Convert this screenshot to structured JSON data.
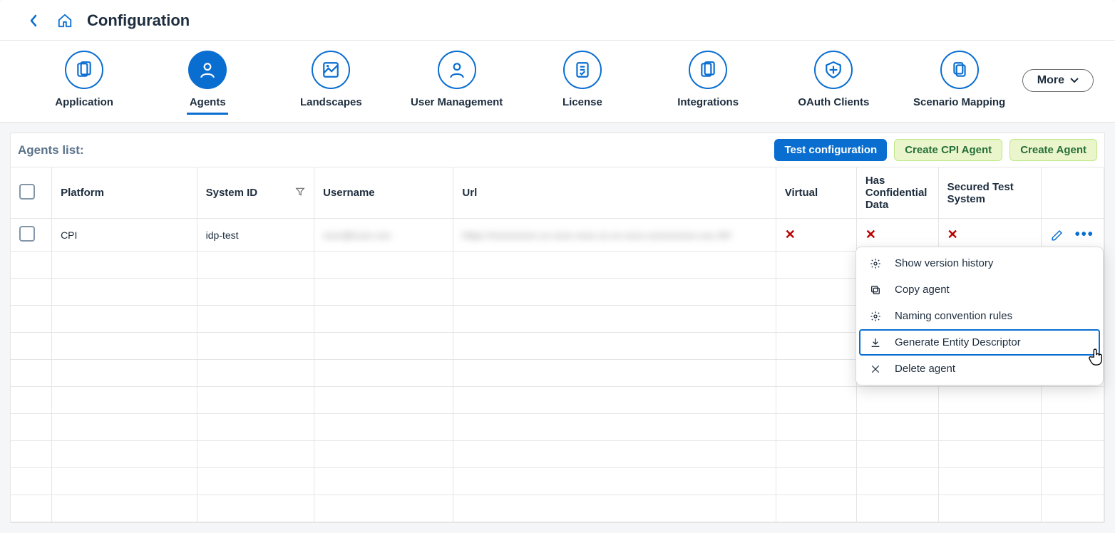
{
  "header": {
    "title": "Configuration"
  },
  "nav": {
    "items": [
      {
        "label": "Application"
      },
      {
        "label": "Agents"
      },
      {
        "label": "Landscapes"
      },
      {
        "label": "User Management"
      },
      {
        "label": "License"
      },
      {
        "label": "Integrations"
      },
      {
        "label": "OAuth Clients"
      },
      {
        "label": "Scenario Mapping"
      }
    ],
    "more_label": "More"
  },
  "agents_list": {
    "title": "Agents list:",
    "buttons": {
      "test_config": "Test configuration",
      "create_cpi": "Create CPI Agent",
      "create_agent": "Create Agent"
    },
    "columns": {
      "platform": "Platform",
      "system_id": "System ID",
      "username": "Username",
      "url": "Url",
      "virtual": "Virtual",
      "has_conf": "Has Confidential Data",
      "secured": "Secured Test System"
    },
    "rows": [
      {
        "platform": "CPI",
        "system_id": "idp-test",
        "username": "xxxx@xxxx.xxx",
        "url": "https://xxxxxxxxx.xx.xxxx-xxxx.xx.xx.xxxx.xxxxxxxxxx.xxx.40/",
        "virtual": "x",
        "has_conf": "x",
        "secured": "x"
      }
    ]
  },
  "context_menu": {
    "items": [
      {
        "icon": "gear",
        "label": "Show version history"
      },
      {
        "icon": "copy",
        "label": "Copy agent"
      },
      {
        "icon": "gear",
        "label": "Naming convention rules"
      },
      {
        "icon": "download",
        "label": "Generate Entity Descriptor",
        "selected": true
      },
      {
        "icon": "x",
        "label": "Delete agent"
      }
    ]
  }
}
